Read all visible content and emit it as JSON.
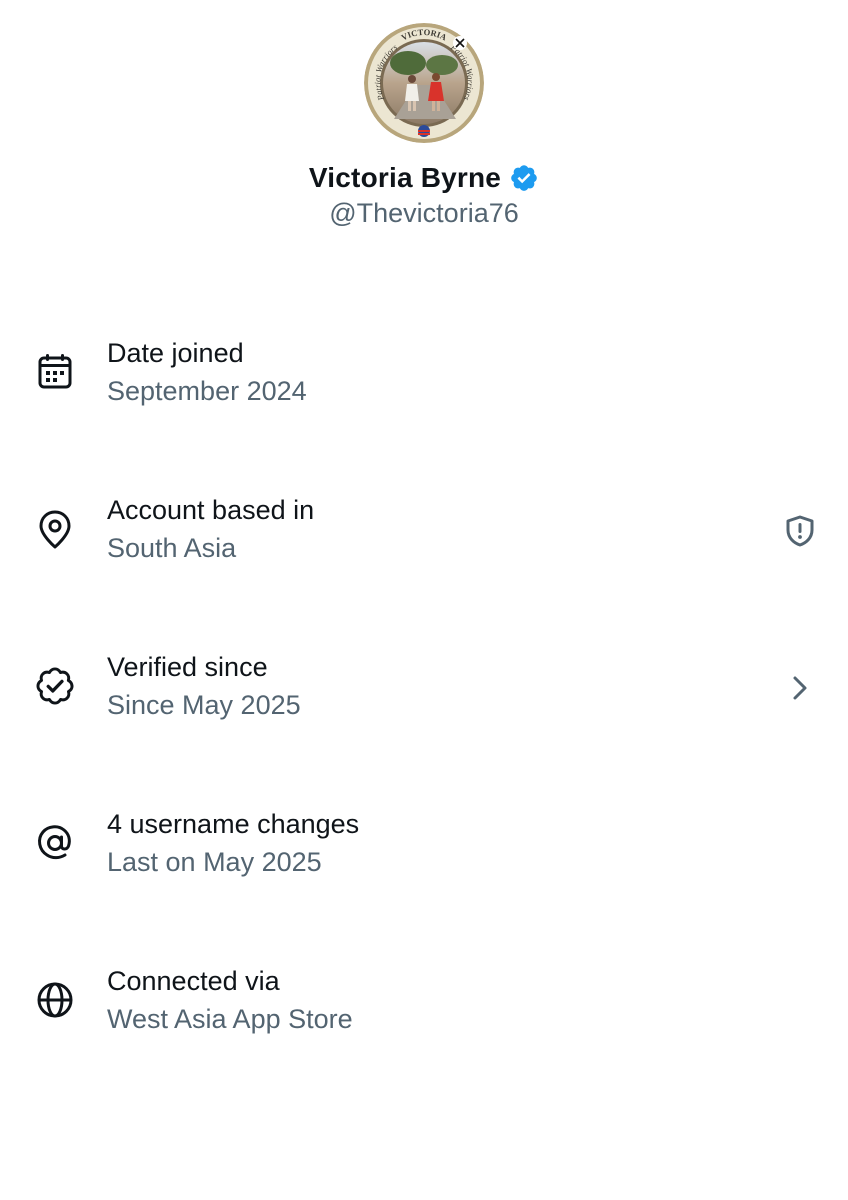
{
  "profile": {
    "name": "Victoria Byrne",
    "handle": "@Thevictoria76",
    "verified": true,
    "verified_color": "#1d9bf0",
    "avatar": {
      "ring_top_text": "VICTORIA",
      "ring_left_text": "Patriot Warriors",
      "ring_right_text": "Patriot Warriors",
      "icon": "x-logo"
    }
  },
  "about_rows": [
    {
      "icon": "calendar-icon",
      "title": "Date joined",
      "subtitle": "September 2024",
      "action_icon": null
    },
    {
      "icon": "location-pin-icon",
      "title": "Account based in",
      "subtitle": "South Asia",
      "action_icon": "shield-alert-icon"
    },
    {
      "icon": "verified-badge-outline-icon",
      "title": "Verified since",
      "subtitle": "Since May 2025",
      "action_icon": "chevron-right-icon"
    },
    {
      "icon": "at-sign-icon",
      "title": "4 username changes",
      "subtitle": "Last on May 2025",
      "action_icon": null
    },
    {
      "icon": "globe-icon",
      "title": "Connected via",
      "subtitle": "West Asia App Store",
      "action_icon": null
    }
  ],
  "colors": {
    "text_primary": "#0f1419",
    "text_secondary": "#536471",
    "background": "#ffffff"
  }
}
